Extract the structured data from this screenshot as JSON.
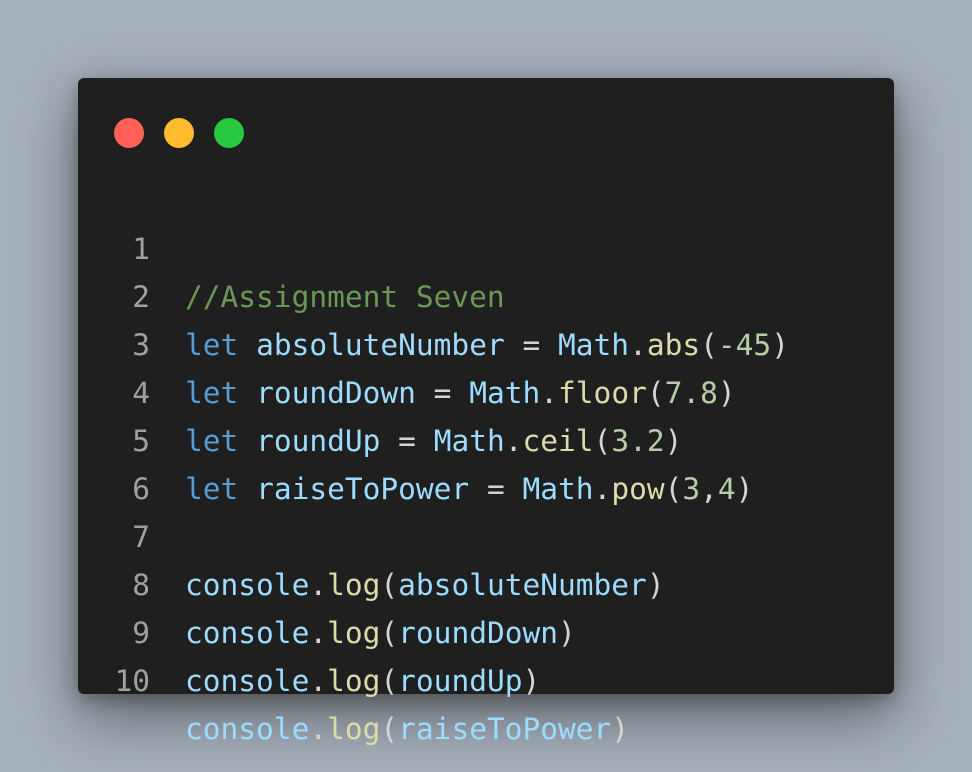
{
  "window": {
    "controls": {
      "close": "close-dot",
      "minimize": "minimize-dot",
      "zoom": "zoom-dot",
      "colors": {
        "close": "#ff5f57",
        "minimize": "#febc2e",
        "zoom": "#28c840"
      }
    }
  },
  "theme": {
    "background": "#1f1f1f",
    "comment": "#6a9955",
    "keyword": "#569cd6",
    "variable": "#9cdcfe",
    "function": "#dcdcaa",
    "number": "#b5cea8",
    "punctuation": "#d4d4d4",
    "line_number": "#a0a0a0"
  },
  "code": {
    "lines": [
      {
        "number": "1",
        "tokens": [
          {
            "type": "comment",
            "text": "//Assignment Seven"
          }
        ]
      },
      {
        "number": "2",
        "tokens": [
          {
            "type": "keyword",
            "text": "let"
          },
          {
            "type": "punct",
            "text": " "
          },
          {
            "type": "var",
            "text": "absoluteNumber"
          },
          {
            "type": "punct",
            "text": " = "
          },
          {
            "type": "var",
            "text": "Math"
          },
          {
            "type": "punct",
            "text": "."
          },
          {
            "type": "fn",
            "text": "abs"
          },
          {
            "type": "punct",
            "text": "("
          },
          {
            "type": "num",
            "text": "-45"
          },
          {
            "type": "punct",
            "text": ")"
          }
        ]
      },
      {
        "number": "3",
        "tokens": [
          {
            "type": "keyword",
            "text": "let"
          },
          {
            "type": "punct",
            "text": " "
          },
          {
            "type": "var",
            "text": "roundDown"
          },
          {
            "type": "punct",
            "text": " = "
          },
          {
            "type": "var",
            "text": "Math"
          },
          {
            "type": "punct",
            "text": "."
          },
          {
            "type": "fn",
            "text": "floor"
          },
          {
            "type": "punct",
            "text": "("
          },
          {
            "type": "num",
            "text": "7.8"
          },
          {
            "type": "punct",
            "text": ")"
          }
        ]
      },
      {
        "number": "4",
        "tokens": [
          {
            "type": "keyword",
            "text": "let"
          },
          {
            "type": "punct",
            "text": " "
          },
          {
            "type": "var",
            "text": "roundUp"
          },
          {
            "type": "punct",
            "text": " = "
          },
          {
            "type": "var",
            "text": "Math"
          },
          {
            "type": "punct",
            "text": "."
          },
          {
            "type": "fn",
            "text": "ceil"
          },
          {
            "type": "punct",
            "text": "("
          },
          {
            "type": "num",
            "text": "3.2"
          },
          {
            "type": "punct",
            "text": ")"
          }
        ]
      },
      {
        "number": "5",
        "tokens": [
          {
            "type": "keyword",
            "text": "let"
          },
          {
            "type": "punct",
            "text": " "
          },
          {
            "type": "var",
            "text": "raiseToPower"
          },
          {
            "type": "punct",
            "text": " = "
          },
          {
            "type": "var",
            "text": "Math"
          },
          {
            "type": "punct",
            "text": "."
          },
          {
            "type": "fn",
            "text": "pow"
          },
          {
            "type": "punct",
            "text": "("
          },
          {
            "type": "num",
            "text": "3"
          },
          {
            "type": "punct",
            "text": ","
          },
          {
            "type": "num",
            "text": "4"
          },
          {
            "type": "punct",
            "text": ")"
          }
        ]
      },
      {
        "number": "6",
        "tokens": []
      },
      {
        "number": "7",
        "tokens": [
          {
            "type": "var",
            "text": "console"
          },
          {
            "type": "punct",
            "text": "."
          },
          {
            "type": "fn",
            "text": "log"
          },
          {
            "type": "punct",
            "text": "("
          },
          {
            "type": "var",
            "text": "absoluteNumber"
          },
          {
            "type": "punct",
            "text": ")"
          }
        ]
      },
      {
        "number": "8",
        "tokens": [
          {
            "type": "var",
            "text": "console"
          },
          {
            "type": "punct",
            "text": "."
          },
          {
            "type": "fn",
            "text": "log"
          },
          {
            "type": "punct",
            "text": "("
          },
          {
            "type": "var",
            "text": "roundDown"
          },
          {
            "type": "punct",
            "text": ")"
          }
        ]
      },
      {
        "number": "9",
        "tokens": [
          {
            "type": "var",
            "text": "console"
          },
          {
            "type": "punct",
            "text": "."
          },
          {
            "type": "fn",
            "text": "log"
          },
          {
            "type": "punct",
            "text": "("
          },
          {
            "type": "var",
            "text": "roundUp"
          },
          {
            "type": "punct",
            "text": ")"
          }
        ]
      },
      {
        "number": "10",
        "tokens": [
          {
            "type": "var",
            "text": "console"
          },
          {
            "type": "punct",
            "text": "."
          },
          {
            "type": "fn",
            "text": "log"
          },
          {
            "type": "punct",
            "text": "("
          },
          {
            "type": "var",
            "text": "raiseToPower"
          },
          {
            "type": "punct",
            "text": ")"
          }
        ]
      }
    ]
  }
}
